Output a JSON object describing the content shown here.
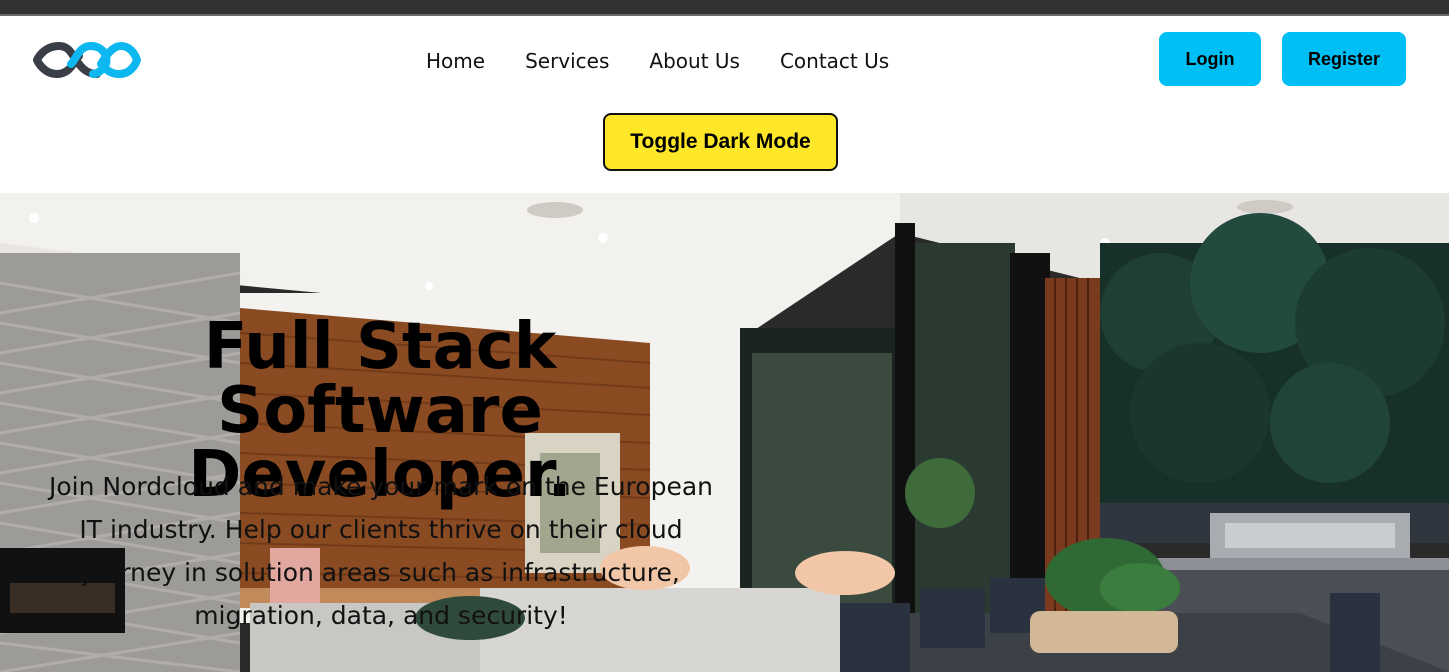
{
  "nav": {
    "logo_icon": "infinity-logo",
    "links": [
      "Home",
      "Services",
      "About Us",
      "Contact Us"
    ],
    "login_label": "Login",
    "register_label": "Register"
  },
  "toggle_label": "Toggle Dark Mode",
  "hero": {
    "title_line1": "Full Stack",
    "title_line2": "Software Developer.",
    "body": "Join Nordcloud and make your mark on the European IT industry. Help our clients thrive on their cloud journey in solution areas such as infrastructure, migration, data, and security!",
    "background": "modern-interior-photo"
  },
  "colors": {
    "accent": "#00bff5",
    "toggle": "#fde728",
    "topbar": "#333333",
    "logo_dark": "#3a3f47",
    "logo_light": "#0cb8ef"
  }
}
